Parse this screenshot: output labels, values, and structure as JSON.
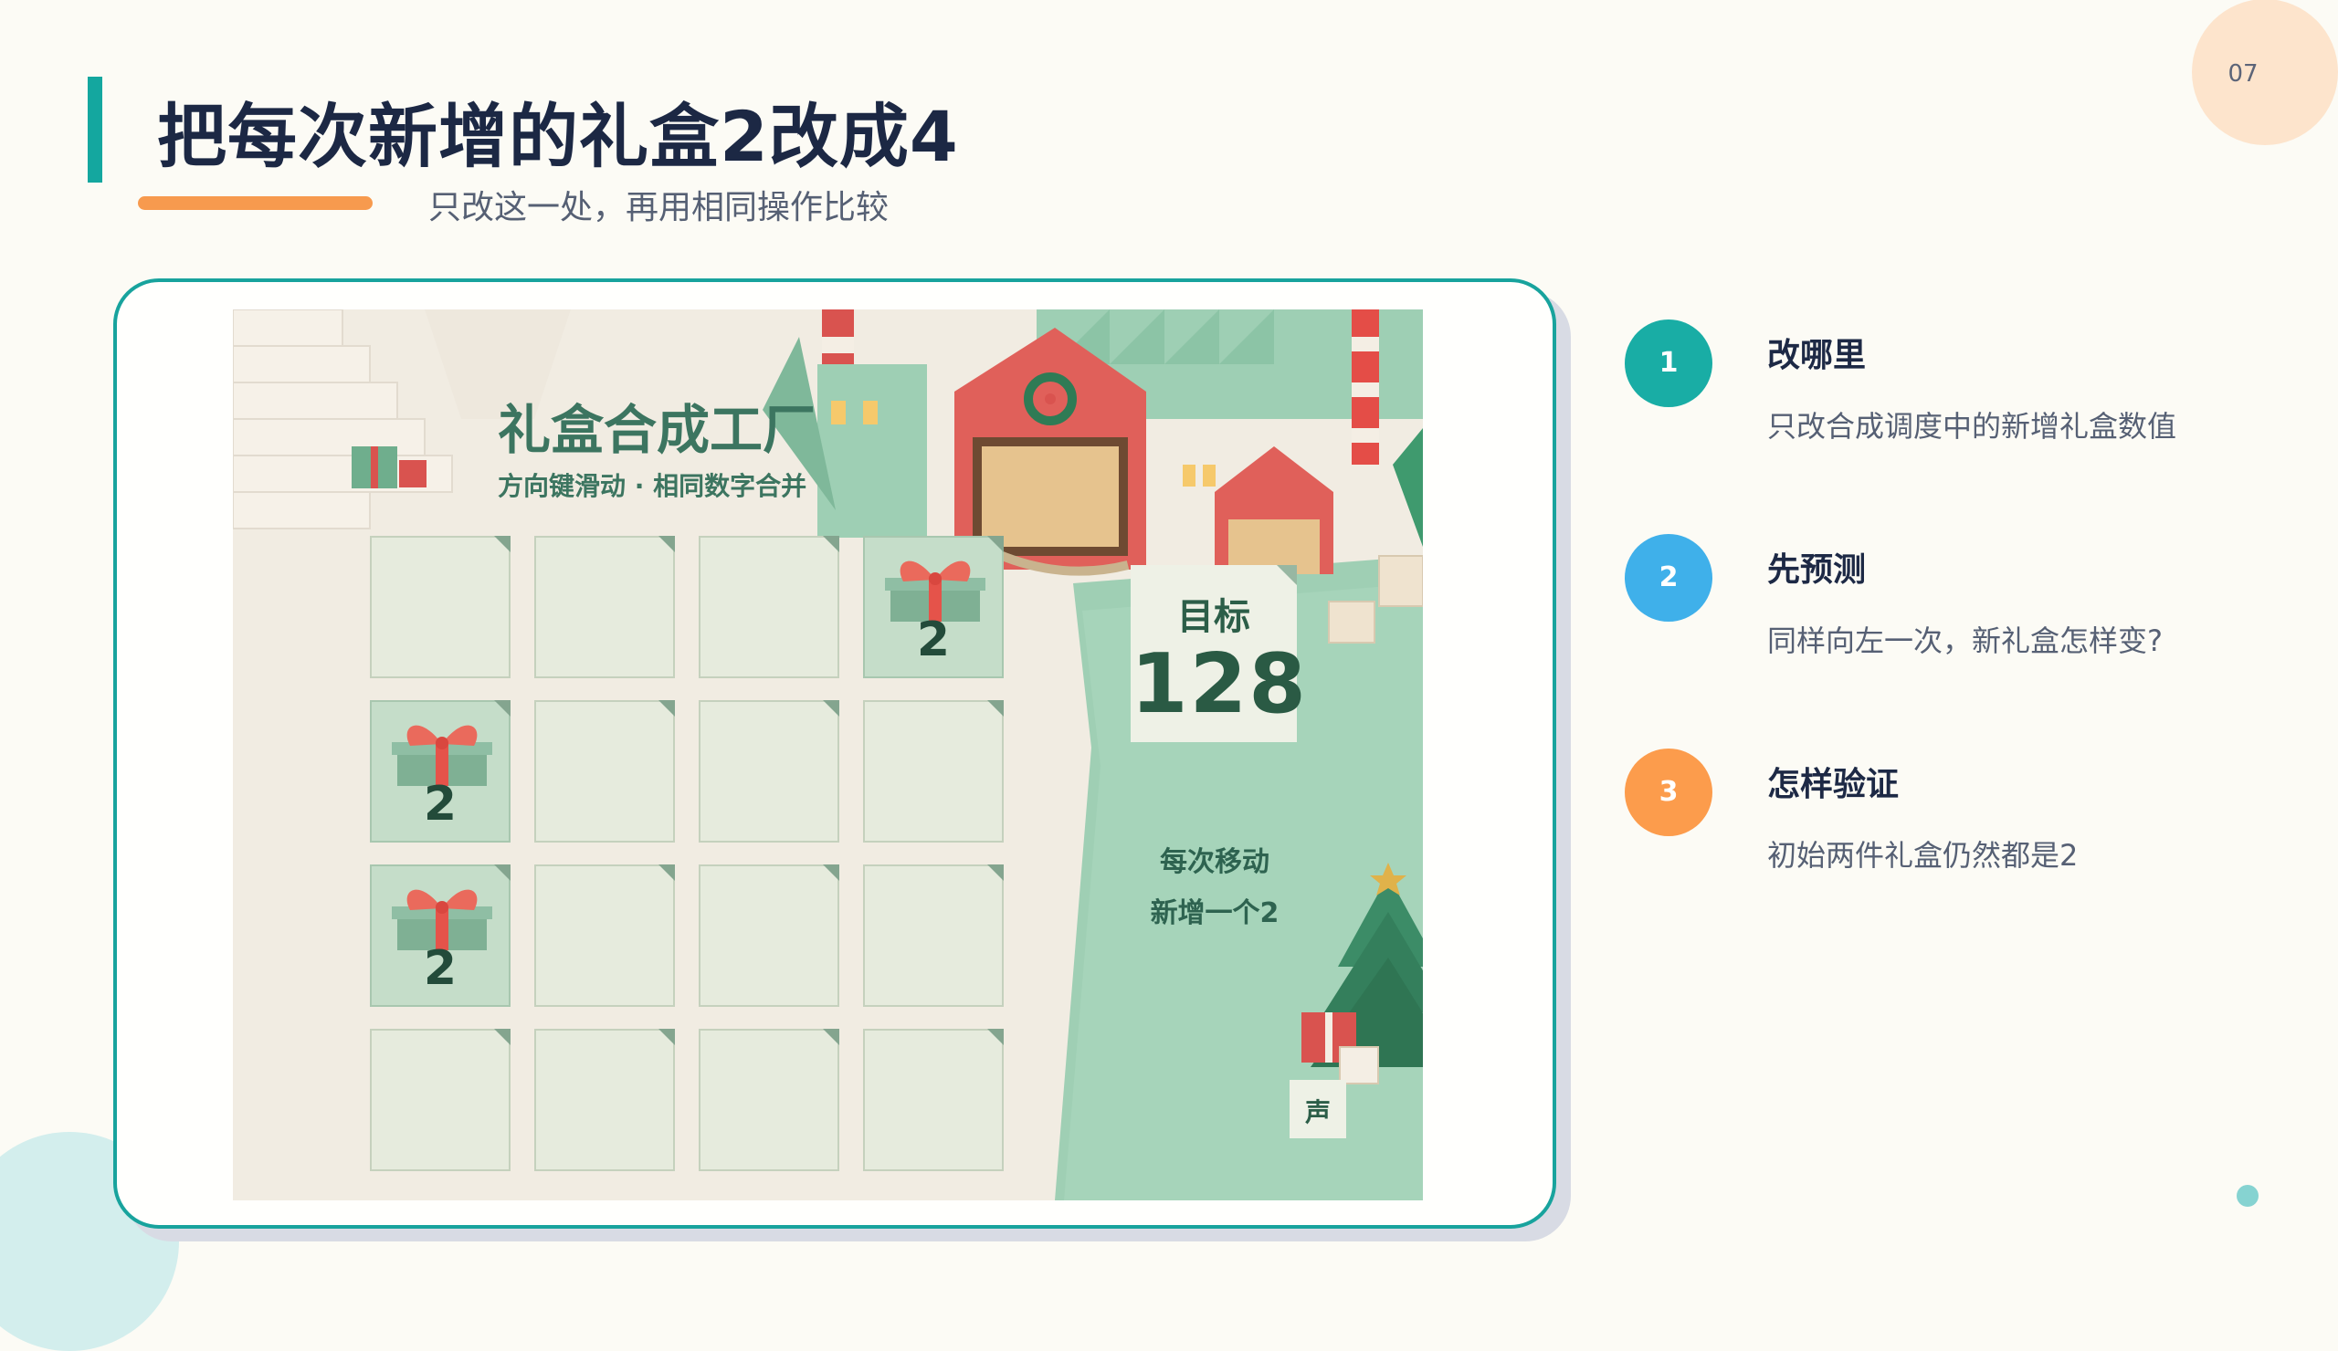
{
  "colors": {
    "page_bg": "#fcfbf5",
    "accent_teal": "#14a79f",
    "accent_orange": "#f79a4e",
    "step_colors": [
      "#19ada5",
      "#3fb0ea",
      "#fc9c4c"
    ],
    "game_green_text": "#3c7560"
  },
  "page": {
    "number": "07"
  },
  "header": {
    "title": "把每次新增的礼盒2改成4",
    "subtitle": "只改这一处，再用相同操作比较"
  },
  "game": {
    "title": "礼盒合成工厂",
    "instructions": "方向键滑动 · 相同数字合并",
    "grid_rows": 4,
    "grid_cols": 4,
    "tiles": [
      [
        "",
        "",
        "",
        "2"
      ],
      [
        "2",
        "",
        "",
        ""
      ],
      [
        "2",
        "",
        "",
        ""
      ],
      [
        "",
        "",
        "",
        ""
      ]
    ],
    "target_label": "目标",
    "target_value": "128",
    "hint_line1": "每次移动",
    "hint_line2": "新增一个2",
    "sound_button": "声"
  },
  "steps": [
    {
      "number": "1",
      "title": "改哪里",
      "desc": "只改合成调度中的新增礼盒数值"
    },
    {
      "number": "2",
      "title": "先预测",
      "desc": "同样向左一次，新礼盒怎样变?"
    },
    {
      "number": "3",
      "title": "怎样验证",
      "desc": "初始两件礼盒仍然都是2"
    }
  ]
}
